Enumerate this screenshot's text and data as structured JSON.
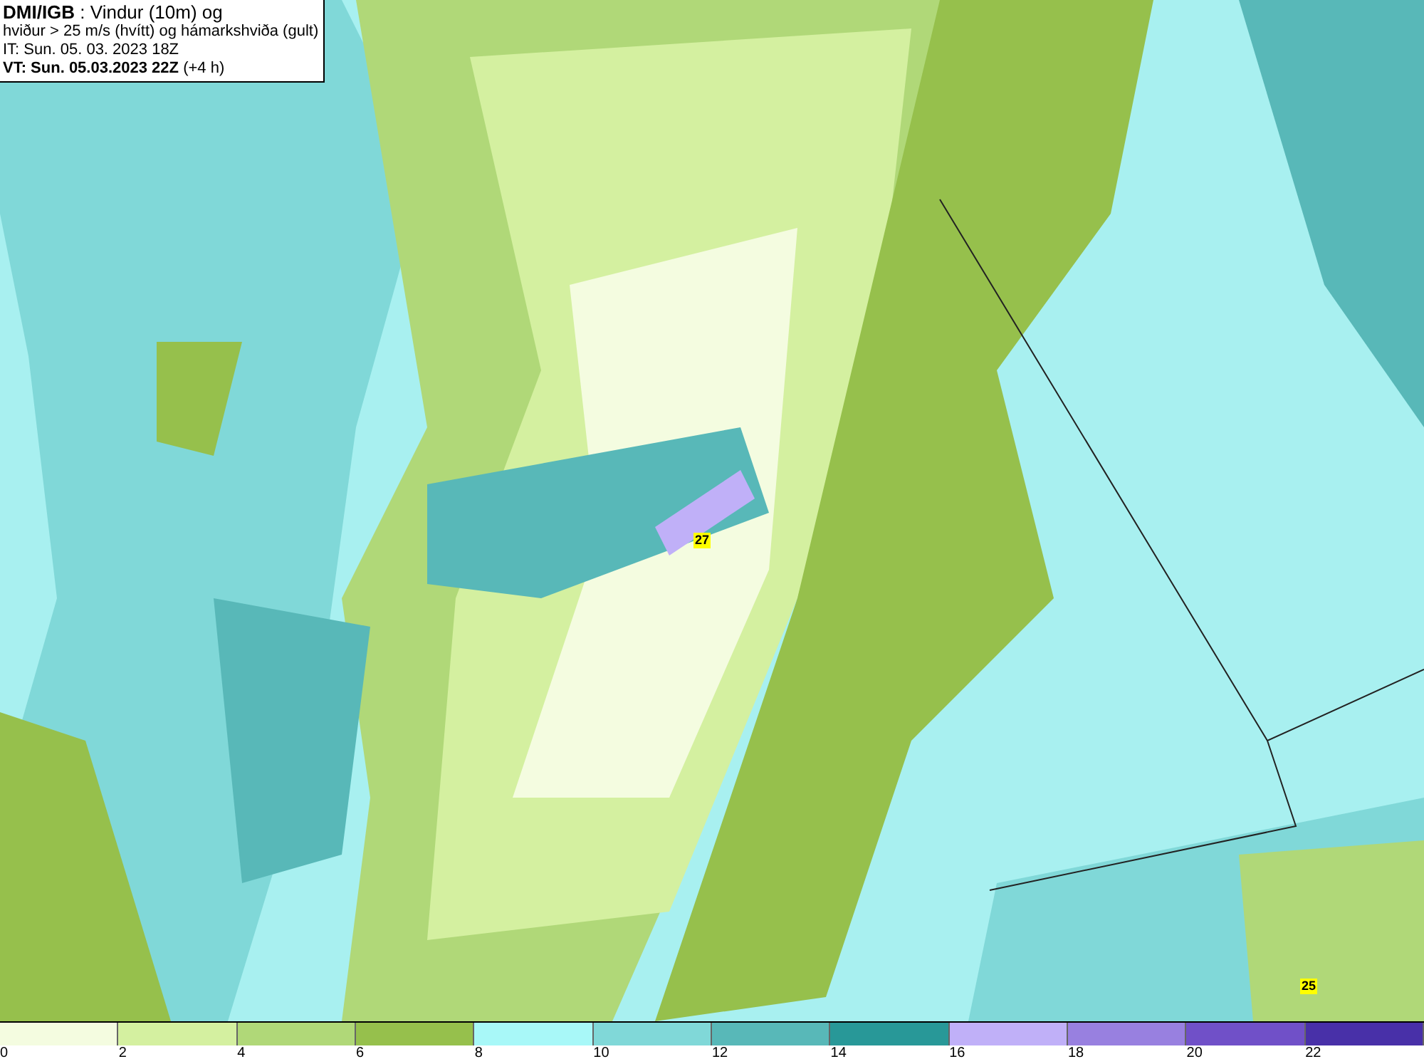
{
  "header": {
    "line1": "**DMI/IGB** : Vindur (10m) og",
    "line2": "hviður > 25 m/s (hvítt) og hámarkshviða (gult)",
    "init_time": "IT: Sun. 05. 03. 2023 18Z",
    "valid_time": "**VT: Sun. 05.03.2023 22Z** (+4 h)"
  },
  "markers": [
    {
      "value": "27"
    },
    {
      "value": "25"
    }
  ],
  "legend": {
    "bins": [
      {
        "color": "#f4fce0",
        "tick": "0"
      },
      {
        "color": "#d4f0a0",
        "tick": "2"
      },
      {
        "color": "#b0d878",
        "tick": "4"
      },
      {
        "color": "#96c04c",
        "tick": "6"
      },
      {
        "color": "#a8f8f8",
        "tick": "8"
      },
      {
        "color": "#80d8d8",
        "tick": "10"
      },
      {
        "color": "#58b8b8",
        "tick": "12"
      },
      {
        "color": "#289898",
        "tick": "14"
      },
      {
        "color": "#c0b0f8",
        "tick": "16"
      },
      {
        "color": "#9880e0",
        "tick": "18"
      },
      {
        "color": "#7050c8",
        "tick": "20"
      },
      {
        "color": "#4830a8",
        "tick": "22"
      }
    ]
  }
}
